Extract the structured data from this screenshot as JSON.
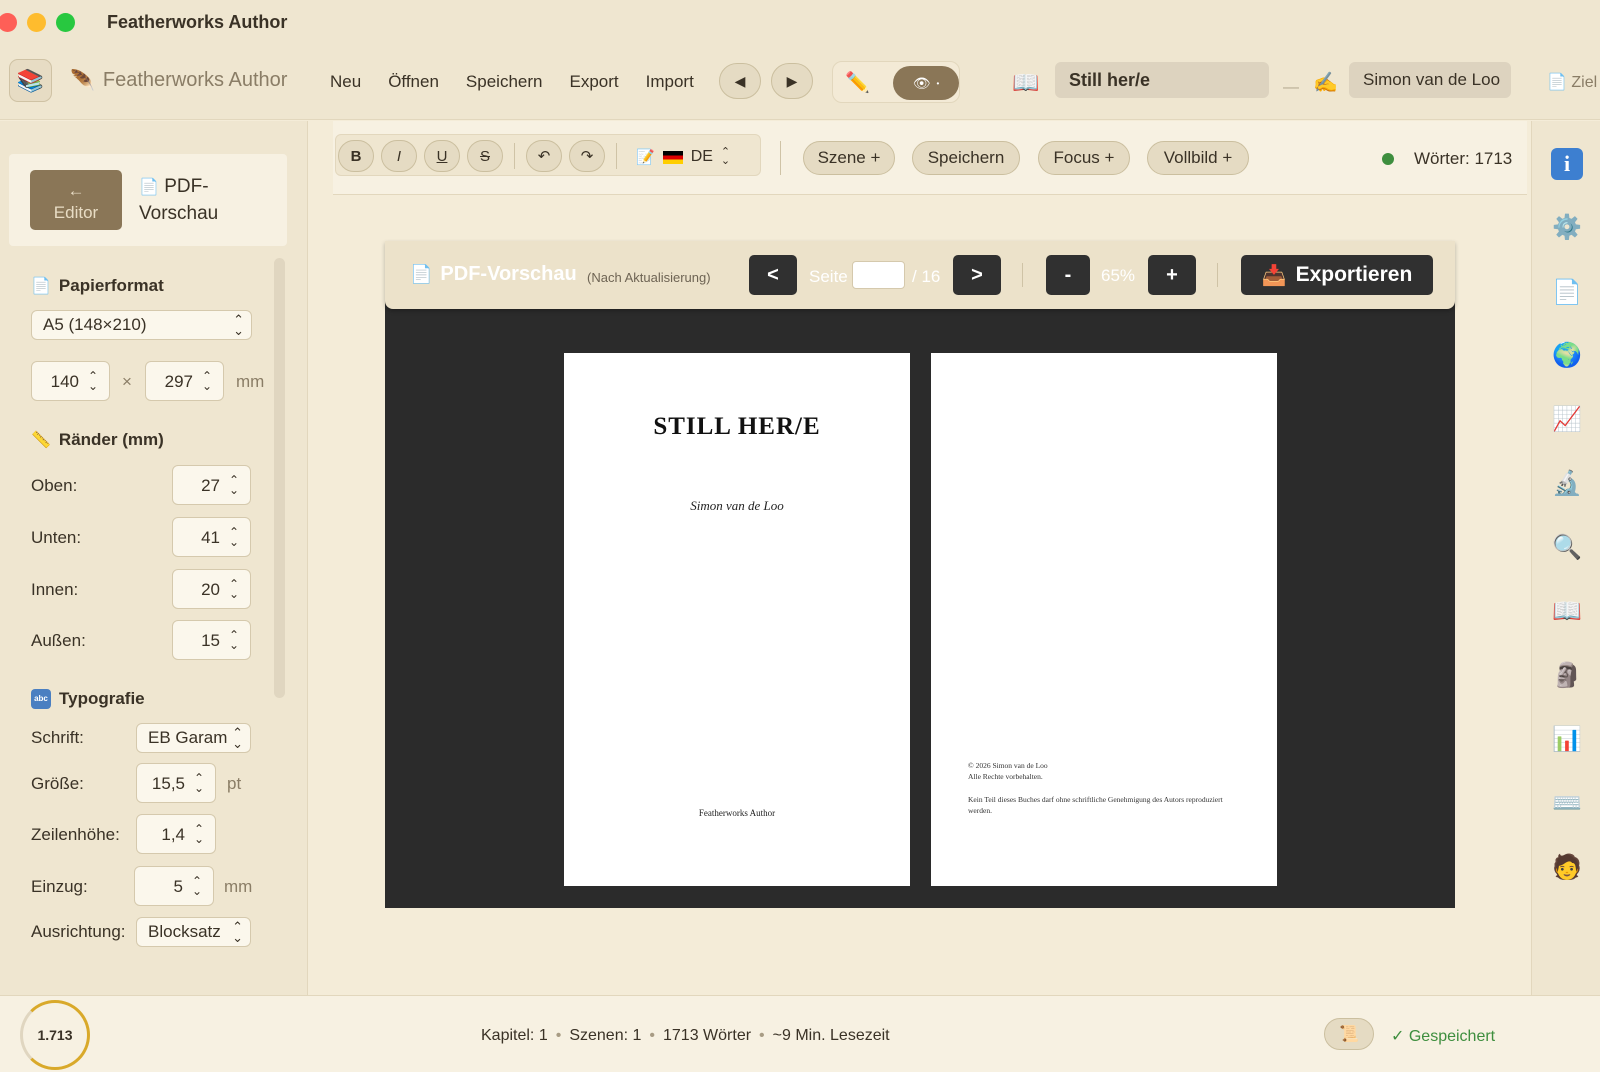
{
  "window": {
    "title": "Featherworks Author"
  },
  "toolbar": {
    "brand": "Featherworks Author",
    "menu": [
      "Neu",
      "Öffnen",
      "Speichern",
      "Export",
      "Import"
    ],
    "title_value": "Still her/e",
    "author_value": "Simon van de Loo",
    "dash": "—",
    "ziel_label": "Ziel"
  },
  "sidebar": {
    "back_arrow": "←",
    "editor_label": "Editor",
    "pdf_label_line1": "PDF-",
    "pdf_label_line2": "Vorschau",
    "papierformat": {
      "title": "Papierformat",
      "format": "A5 (148×210)",
      "width": "140",
      "height": "297",
      "times": "×",
      "unit": "mm"
    },
    "raender": {
      "title": "Ränder (mm)",
      "oben_label": "Oben:",
      "oben": "27",
      "unten_label": "Unten:",
      "unten": "41",
      "innen_label": "Innen:",
      "innen": "20",
      "aussen_label": "Außen:",
      "aussen": "15"
    },
    "typografie": {
      "title": "Typografie",
      "badge": "abc",
      "schrift_label": "Schrift:",
      "schrift": "EB Garam",
      "groesse_label": "Größe:",
      "groesse": "15,5",
      "groesse_unit": "pt",
      "zeilenhoehe_label": "Zeilenhöhe:",
      "zeilenhoehe": "1,4",
      "einzug_label": "Einzug:",
      "einzug": "5",
      "einzug_unit": "mm",
      "ausrichtung_label": "Ausrichtung:",
      "ausrichtung": "Blocksatz"
    }
  },
  "editor_toolbar": {
    "bold": "B",
    "italic": "I",
    "underline": "U",
    "strike": "S",
    "language": "DE",
    "buttons": [
      "Szene +",
      "Speichern",
      "Focus +",
      "Vollbild +"
    ],
    "words": "Wörter: 1713"
  },
  "preview": {
    "title": "PDF-Vorschau",
    "subtitle": "(Nach Aktualisierung)",
    "prev": "<",
    "next": ">",
    "page_label": "Seite",
    "page_total": "/ 16",
    "zoom_out": "-",
    "zoom_in": "+",
    "zoom": "65%",
    "export": "Exportieren"
  },
  "page_left": {
    "title": "STILL HER/E",
    "author": "Simon van de Loo",
    "publisher": "Featherworks Author"
  },
  "page_right": {
    "copyright": "© 2026 Simon van de Loo",
    "rights": "Alle Rechte vorbehalten.",
    "notice": "Kein Teil dieses Buches darf ohne schriftliche Genehmigung des Autors reproduziert werden."
  },
  "statusbar": {
    "word_count": "1.713",
    "kapitel": "Kapitel: 1",
    "szenen": "Szenen: 1",
    "woerter": "1713 Wörter",
    "lesezeit": "~9 Min. Lesezeit",
    "bullet": "•",
    "saved": "✓ Gespeichert"
  },
  "colors": {
    "accent": "#8a7657",
    "background": "#f4ecd8",
    "preview_bg": "#2b2b2b",
    "saved_green": "#3e8e3e",
    "info_blue": "#3d7fd0"
  }
}
